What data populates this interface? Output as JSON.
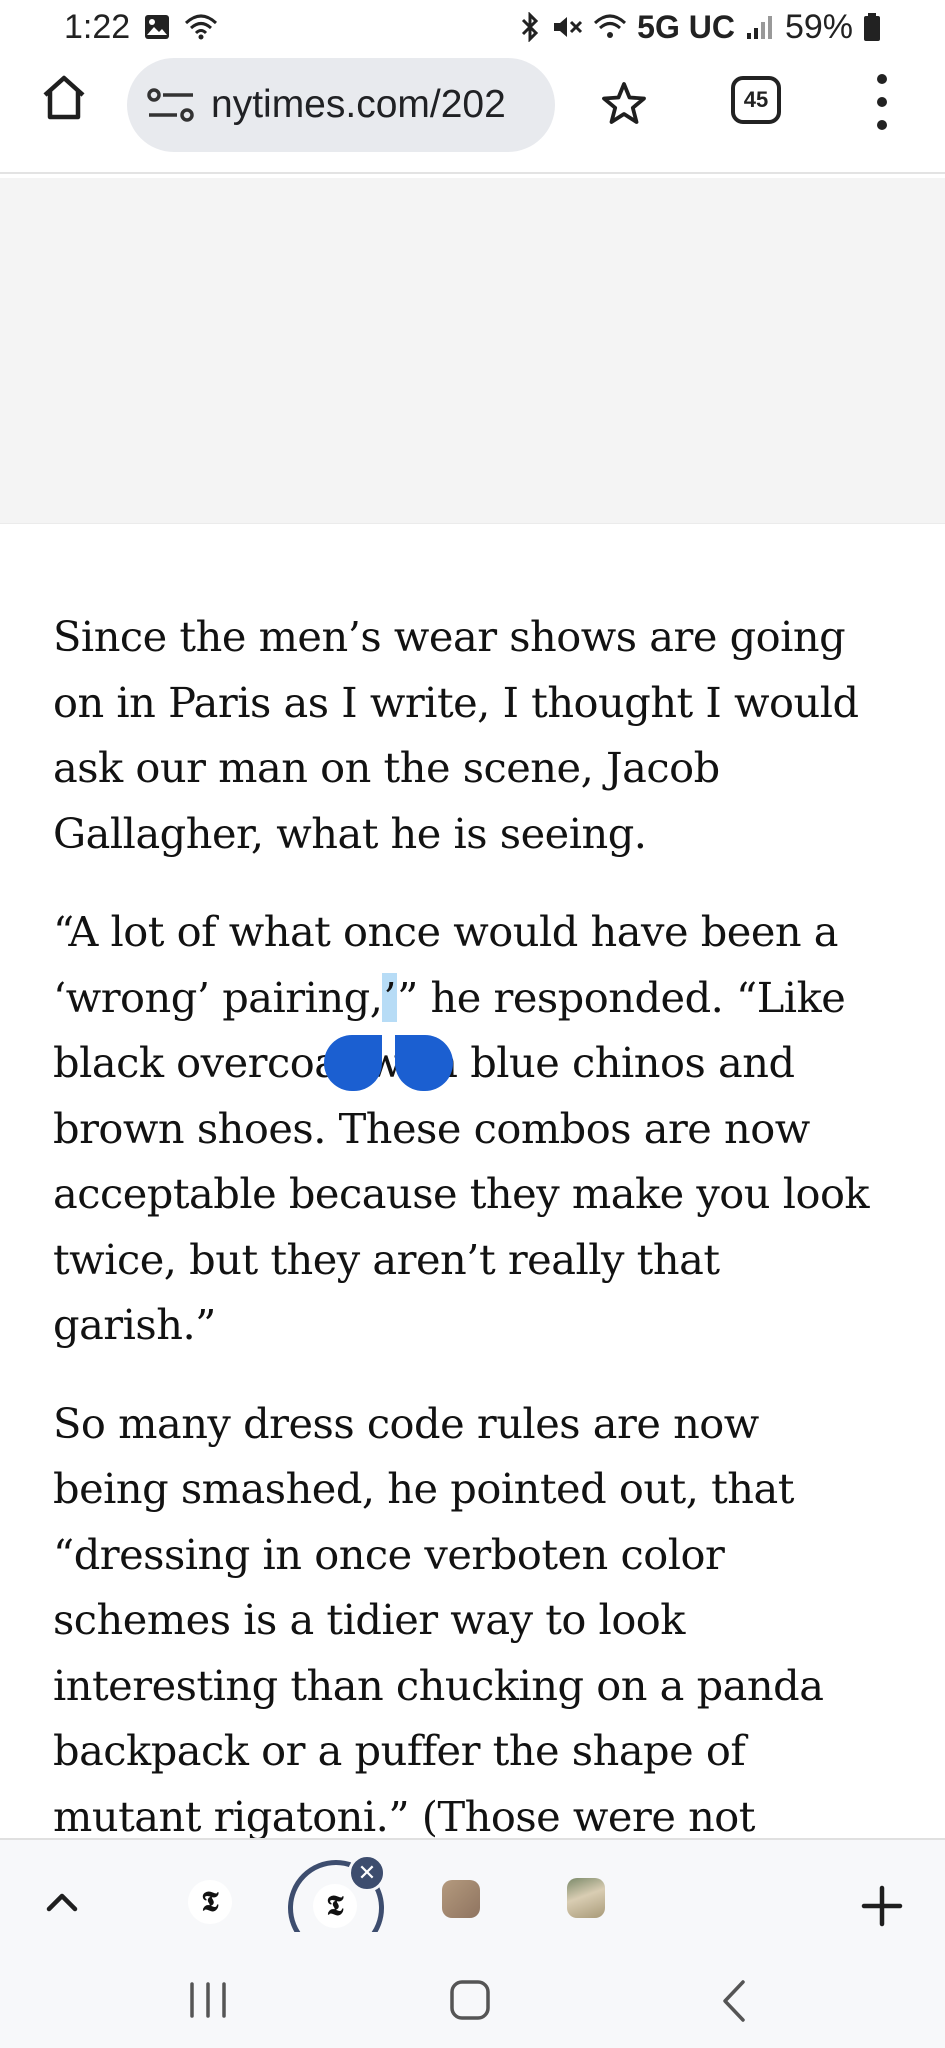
{
  "status_bar": {
    "time": "1:22",
    "network": "5G UC",
    "battery": "59%",
    "icons": [
      "image-icon",
      "wifi-calling-icon",
      "bluetooth-icon",
      "mute-icon",
      "wifi-icon",
      "signal-icon",
      "battery-icon"
    ]
  },
  "browser": {
    "url": "nytimes.com/202",
    "tab_count": "45",
    "icons": [
      "home-icon",
      "site-settings-icon",
      "star-icon",
      "tabs-icon",
      "more-icon"
    ]
  },
  "article": {
    "paragraphs": [
      {
        "lines": [
          "Since the men’s wear shows are going",
          "on in Paris as I write, I thought I would",
          "ask our man on the scene, Jacob",
          "Gallagher, what he is seeing."
        ]
      },
      {
        "lines": [
          "“A lot of what once would have been a",
          "‘wrong’ pairing,",
          "” he responded. “Like",
          "black overcoat with blue chinos and",
          "brown shoes. These combos are now",
          "acceptable because they make you look",
          "twice, but they aren’t really that",
          "garish.”"
        ],
        "selected_text": "’"
      },
      {
        "lines": [
          "So many dress code rules are now",
          "being smashed, he pointed out, that",
          "“dressing in once verboten color",
          "schemes is a tidier way to look",
          "interesting than chucking on a panda",
          "backpack or a puffer the shape of",
          "mutant rigatoni.” (Those were not"
        ]
      }
    ]
  },
  "tab_strip": {
    "thumb_logo": "𝕿",
    "close_glyph": "✕",
    "tabs": [
      "nyt-tab",
      "nyt-tab-active",
      "photo-tab",
      "photo-tab-2"
    ]
  },
  "colors": {
    "selection_handle": "#1b5fd1",
    "selection_highlight": "#b7dcf6",
    "active_tab_ring": "#3d4d6e",
    "url_pill": "#e8eaee"
  }
}
